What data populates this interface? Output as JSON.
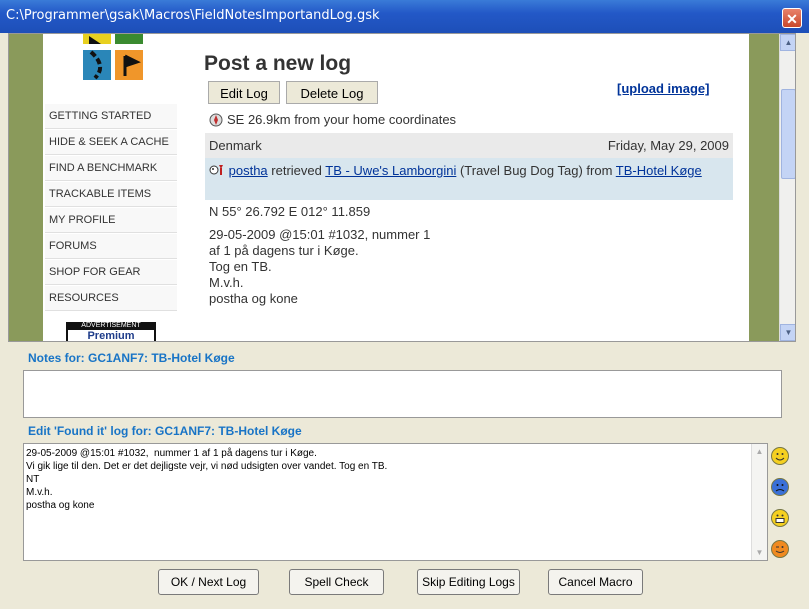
{
  "window": {
    "title": "C:\\Programmer\\gsak\\Macros\\FieldNotesImportandLog.gsk"
  },
  "nav": {
    "items": [
      "GETTING STARTED",
      "HIDE & SEEK A CACHE",
      "FIND A BENCHMARK",
      "TRACKABLE ITEMS",
      "MY PROFILE",
      "FORUMS",
      "SHOP FOR GEAR",
      "RESOURCES"
    ]
  },
  "ad": {
    "label": "ADVERTISEMENT",
    "text": "Premium"
  },
  "post": {
    "title": "Post a new log",
    "edit_btn": "Edit Log",
    "delete_btn": "Delete Log",
    "upload_link": "[upload image]",
    "distance": "SE 26.9km from your home coordinates",
    "country": "Denmark",
    "date": "Friday, May 29, 2009",
    "log_user": "postha",
    "log_action": " retrieved ",
    "log_item": "TB - Uwe's Lamborgini",
    "log_type": " (Travel Bug Dog Tag) from ",
    "log_cache": "TB-Hotel Køge",
    "coords": "N 55° 26.792 E 012° 11.859",
    "log_lines": [
      "29-05-2009 @15:01 #1032, nummer 1",
      "af 1 på dagens tur i Køge.",
      "Tog en TB.",
      "M.v.h.",
      "postha og kone"
    ]
  },
  "notes": {
    "label": "Notes for: GC1ANF7: TB-Hotel Køge",
    "value": ""
  },
  "edit": {
    "label": "Edit 'Found it' log for: GC1ANF7: TB-Hotel Køge",
    "value": "29-05-2009 @15:01 #1032,  nummer 1 af 1 på dagens tur i Køge.\nVi gik lige til den. Det er det dejligste vejr, vi nød udsigten over vandet. Tog en TB.\nNT\nM.v.h.\npostha og kone"
  },
  "buttons": {
    "ok": "OK / Next Log",
    "spell": "Spell Check",
    "skip": "Skip Editing Logs",
    "cancel": "Cancel Macro"
  },
  "colors": {
    "title_bar": "#2358c7",
    "accent_label": "#1874c6",
    "link": "#003399",
    "green_frame": "#8a9a5b"
  }
}
